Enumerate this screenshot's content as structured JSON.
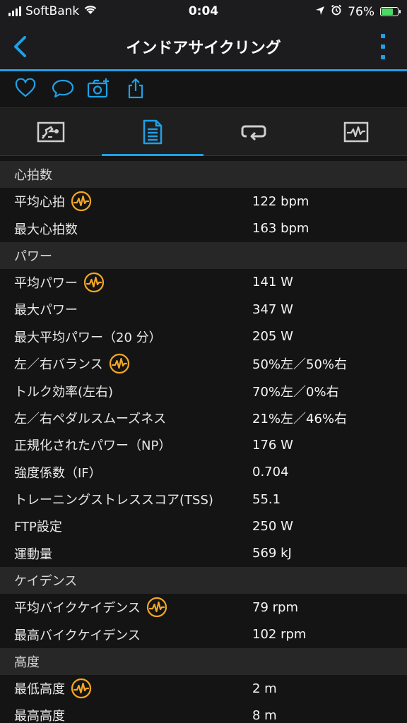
{
  "status_bar": {
    "carrier": "SoftBank",
    "time": "0:04",
    "battery_percent": "76%",
    "battery_level": 0.76
  },
  "nav": {
    "title": "インドアサイクリング"
  },
  "colors": {
    "accent": "#1fa0e6",
    "chart_icon": "#f5a623",
    "battery": "#4cd964"
  },
  "actions": [
    "heart-icon",
    "comment-icon",
    "camera-add-icon",
    "share-icon"
  ],
  "tabs": [
    {
      "icon": "map-icon",
      "active": false
    },
    {
      "icon": "details-list-icon",
      "active": true
    },
    {
      "icon": "laps-loop-icon",
      "active": false
    },
    {
      "icon": "graph-icon",
      "active": false
    }
  ],
  "sections": [
    {
      "title": "心拍数",
      "rows": [
        {
          "label": "平均心拍",
          "value": "122 bpm",
          "chart": true
        },
        {
          "label": "最大心拍数",
          "value": "163 bpm",
          "chart": false
        }
      ]
    },
    {
      "title": "パワー",
      "rows": [
        {
          "label": "平均パワー",
          "value": "141 W",
          "chart": true
        },
        {
          "label": "最大パワー",
          "value": "347 W",
          "chart": false
        },
        {
          "label": "最大平均パワー（20 分）",
          "value": "205 W",
          "chart": false
        },
        {
          "label": "左／右バランス",
          "value": "50%左／50%右",
          "chart": true
        },
        {
          "label": "トルク効率(左右)",
          "value": "70%左／0%右",
          "chart": false
        },
        {
          "label": "左／右ペダルスムーズネス",
          "value": "21%左／46%右",
          "chart": false
        },
        {
          "label": "正規化されたパワー（NP）",
          "value": "176 W",
          "chart": false
        },
        {
          "label": "強度係数（IF）",
          "value": "0.704",
          "chart": false
        },
        {
          "label": "トレーニングストレススコア(TSS)",
          "value": "55.1",
          "chart": false
        },
        {
          "label": "FTP設定",
          "value": "250 W",
          "chart": false
        },
        {
          "label": "運動量",
          "value": "569 kJ",
          "chart": false
        }
      ]
    },
    {
      "title": "ケイデンス",
      "rows": [
        {
          "label": "平均バイクケイデンス",
          "value": "79 rpm",
          "chart": true
        },
        {
          "label": "最高バイクケイデンス",
          "value": "102 rpm",
          "chart": false
        }
      ]
    },
    {
      "title": "高度",
      "rows": [
        {
          "label": "最低高度",
          "value": "2 m",
          "chart": true
        },
        {
          "label": "最高高度",
          "value": "8 m",
          "chart": false
        }
      ]
    }
  ]
}
